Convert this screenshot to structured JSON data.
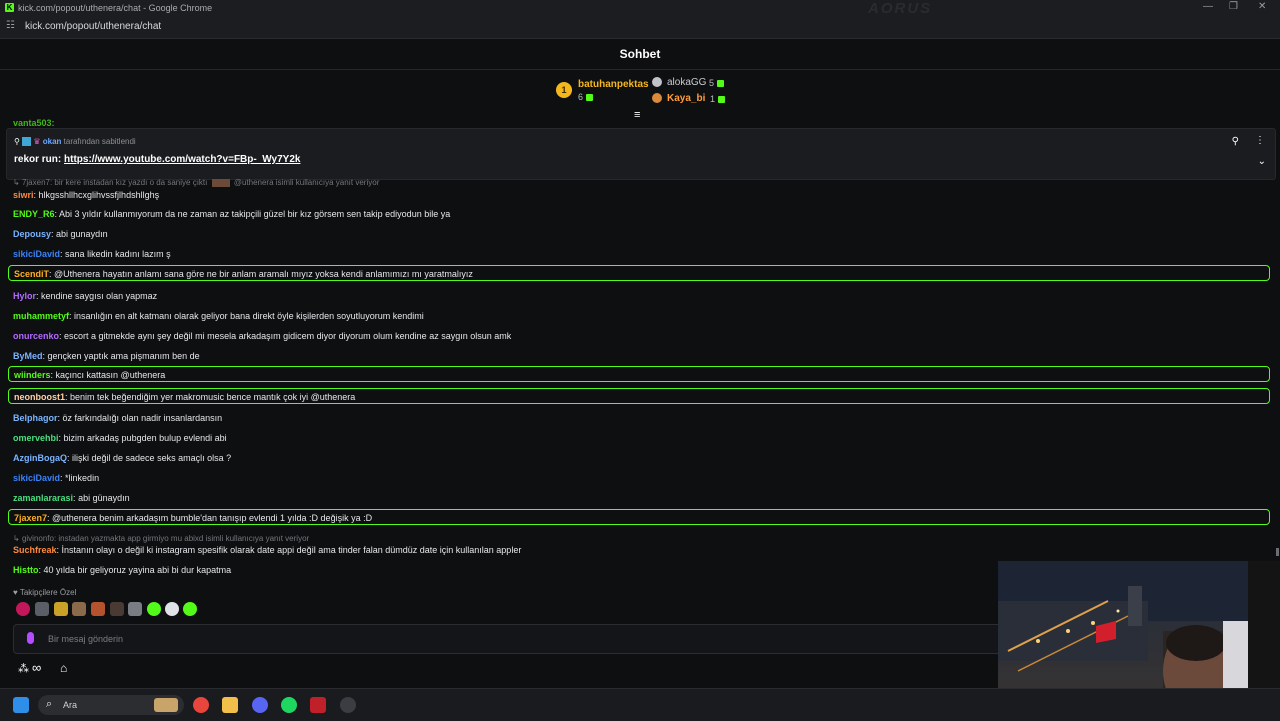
{
  "window": {
    "title": "kick.com/popout/uthenera/chat - Google Chrome",
    "url": "kick.com/popout/uthenera/chat",
    "watermark": "AORUS"
  },
  "header": {
    "title": "Sohbet"
  },
  "leaderboard": [
    {
      "rank": "1",
      "name": "batuhanpektas",
      "count": "6"
    },
    {
      "rank": "",
      "name": "alokaGG",
      "count": "5"
    },
    {
      "rank": "",
      "name": "Kaya_bi",
      "count": "1"
    }
  ],
  "scrolled_partial": "vanta503:",
  "pinned": {
    "user": "okan",
    "by_text": "tarafından sabitlendi",
    "prefix": "rekor run:",
    "link": "https://www.youtube.com/watch?v=FBp-_Wy7Y2k"
  },
  "replies": [
    {
      "text": "7jaxen7: bir kere instadan kız yazdı o da saniye çıktı",
      "suffix": "@uthenera isimli kullanıcıya yanıt veriyor"
    },
    {
      "text": "givinonfo: instadan yazmakta app girmiyo mu abixd isimli kullanıcıya yanıt veriyor",
      "suffix": ""
    }
  ],
  "messages": [
    {
      "user": "siwri",
      "color": "#ff8a3d",
      "text": "hlkgsshllhcxglihvssfjlhdshllghş",
      "highlight": false
    },
    {
      "user": "ENDY_R6",
      "color": "#53fc18",
      "text": "Abi 3 yıldır kullanmıyorum da ne zaman az takipçili güzel bir kız görsem sen takip ediyodun bile ya",
      "highlight": false
    },
    {
      "user": "Depousy",
      "color": "#7ab4ff",
      "text": "abi gunaydın",
      "highlight": false
    },
    {
      "user": "sikiciDavid",
      "color": "#3b82f6",
      "text": "sana likedin kadını lazım ş",
      "highlight": false
    },
    {
      "user": "ScendiT",
      "color": "#ffb020",
      "text": "@Uthenera hayatın anlamı sana göre ne bir anlam aramalı mıyız yoksa kendi anlamımızı mı yaratmalıyız",
      "highlight": true
    },
    {
      "user": "Hylor",
      "color": "#b36bff",
      "text": "kendine saygısı olan yapmaz",
      "highlight": false
    },
    {
      "user": "muhammetyf",
      "color": "#53fc18",
      "text": "insanlığın en alt katmanı olarak geliyor bana direkt öyle kişilerden soyutluyorum kendimi",
      "highlight": false
    },
    {
      "user": "onurcenko",
      "color": "#b36bff",
      "text": "escort a gitmekde aynı şey değil mi mesela arkadaşım gidicem diyor diyorum olum kendine az saygın olsun amk",
      "highlight": false
    },
    {
      "user": "ByMed",
      "color": "#7ab4ff",
      "text": "gençken yaptık ama pişmanım ben de",
      "highlight": false
    },
    {
      "user": "wiinders",
      "color": "#53fc18",
      "text": "kaçıncı kattasın @uthenera",
      "highlight": true
    },
    {
      "user": "neonboost1",
      "color": "#ffd2a0",
      "text": "benim tek beğendiğim yer makromusic bence mantık çok iyi @uthenera",
      "highlight": true
    },
    {
      "user": "Belphagor",
      "color": "#7ab4ff",
      "text": "öz farkındalığı olan nadir insanlardansın",
      "highlight": false
    },
    {
      "user": "omervehbi",
      "color": "#4ade80",
      "text": "bizim arkadaş pubgden bulup evlendi abi",
      "highlight": false
    },
    {
      "user": "AzginBogaQ",
      "color": "#7ab4ff",
      "text": "ilişki değil de sadece seks amaçlı olsa ?",
      "highlight": false
    },
    {
      "user": "sikiciDavid",
      "color": "#3b82f6",
      "text": "*linkedin",
      "highlight": false
    },
    {
      "user": "zamanlararasi",
      "color": "#4ade80",
      "text": "abi günaydın",
      "highlight": false
    },
    {
      "user": "7jaxen7",
      "color": "#ffb020",
      "text": "@uthenera benim arkadaşım bumble'dan tanışıp evlendi 1 yılda :D değişik ya :D",
      "highlight": true
    },
    {
      "user": "Suchfreak",
      "color": "#ff8a3d",
      "text": "İnstanın olayı o değil ki instagram spesifik olarak date appi değil ama tinder falan dümdüz date için kullanılan appler",
      "highlight": false
    },
    {
      "user": "Histto",
      "color": "#53fc18",
      "text": "40 yılda bir geliyoruz yayina abi bi dur kapatma",
      "highlight": false
    }
  ],
  "followers_only": "Takipçilere Özel",
  "input": {
    "placeholder": "Bir mesaj gönderin"
  },
  "taskbar": {
    "search_placeholder": "Ara"
  }
}
